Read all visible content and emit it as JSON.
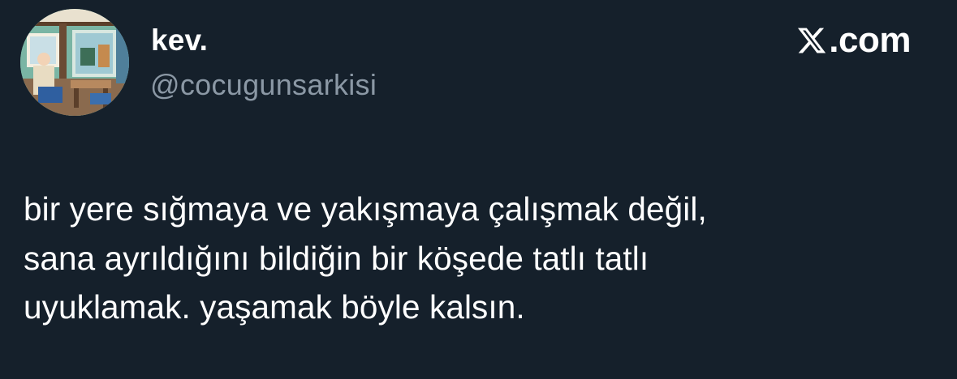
{
  "colors": {
    "background": "#15202b",
    "primary_text": "#ffffff",
    "secondary_text": "#8b98a5"
  },
  "user": {
    "display_name": "kev.",
    "handle": "@cocugunsarkisi",
    "avatar_icon": "illustrated-room-avatar"
  },
  "brand": {
    "icon": "x-logo-icon",
    "text": ".com"
  },
  "tweet": {
    "lines": [
      "bir yere sığmaya ve yakışmaya çalışmak değil,",
      "sana ayrıldığını bildiğin bir köşede tatlı tatlı",
      "uyuklamak. yaşamak böyle kalsın."
    ]
  }
}
